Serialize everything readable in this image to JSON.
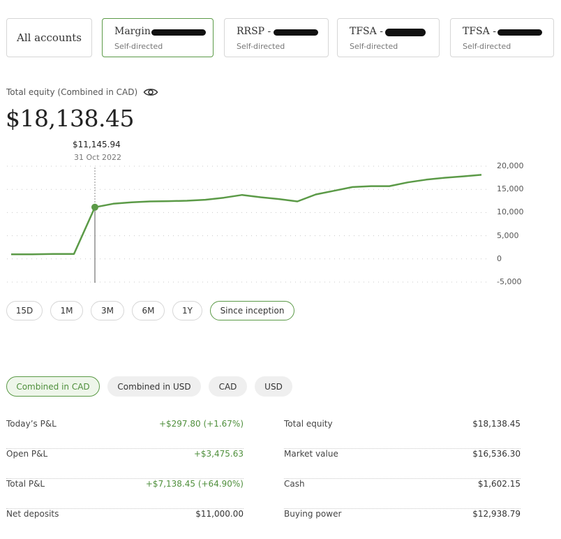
{
  "accounts": [
    {
      "label": "All accounts",
      "subtitle": "",
      "selected": false
    },
    {
      "label": "Margin",
      "subtitle": "Self-directed",
      "selected": true
    },
    {
      "label": "RRSP -",
      "subtitle": "Self-directed",
      "selected": false
    },
    {
      "label": "TFSA -",
      "subtitle": "Self-directed",
      "selected": false
    },
    {
      "label": "TFSA -",
      "subtitle": "Self-directed",
      "selected": false
    }
  ],
  "equity": {
    "label": "Total equity (Combined in CAD)",
    "value": "$18,138.45",
    "visibility_icon": "eye-icon"
  },
  "tooltip": {
    "value": "$11,145.94",
    "date": "31 Oct 2022"
  },
  "chart_data": {
    "type": "line",
    "series": [
      {
        "values": [
          1000,
          1000,
          1050,
          1050,
          11146,
          11900,
          12200,
          12400,
          12450,
          12550,
          12750,
          13200,
          13800,
          13300,
          12900,
          12400,
          13900,
          14700,
          15500,
          15700,
          15700,
          16500,
          17100,
          17500,
          17800,
          18138
        ]
      }
    ],
    "highlight_index": 4,
    "y_ticks": [
      "20,000",
      "15,000",
      "10,000",
      "5,000",
      "0",
      "-5,000"
    ],
    "ylim": [
      -5000,
      20000
    ],
    "grid": "dotted horizontal",
    "color": "#5b9a47"
  },
  "ranges": [
    {
      "label": "15D",
      "selected": false
    },
    {
      "label": "1M",
      "selected": false
    },
    {
      "label": "3M",
      "selected": false
    },
    {
      "label": "6M",
      "selected": false
    },
    {
      "label": "1Y",
      "selected": false
    },
    {
      "label": "Since inception",
      "selected": true
    }
  ],
  "currencies": [
    {
      "label": "Combined in CAD",
      "selected": true
    },
    {
      "label": "Combined in USD",
      "selected": false
    },
    {
      "label": "CAD",
      "selected": false
    },
    {
      "label": "USD",
      "selected": false
    }
  ],
  "stats_left": [
    {
      "label": "Today’s P&L",
      "value": "+$297.80 (+1.67%)",
      "positive": true
    },
    {
      "label": "Open P&L",
      "value": "+$3,475.63",
      "positive": true
    },
    {
      "label": "Total P&L",
      "value": "+$7,138.45 (+64.90%)",
      "positive": true
    },
    {
      "label": "Net deposits",
      "value": "$11,000.00",
      "positive": false
    }
  ],
  "stats_right": [
    {
      "label": "Total equity",
      "value": "$18,138.45"
    },
    {
      "label": "Market value",
      "value": "$16,536.30"
    },
    {
      "label": "Cash",
      "value": "$1,602.15"
    },
    {
      "label": "Buying power",
      "value": "$12,938.79"
    }
  ],
  "colors": {
    "accent": "#5b9a47",
    "positive": "#4f8f3c",
    "border": "#d6d6d6"
  }
}
